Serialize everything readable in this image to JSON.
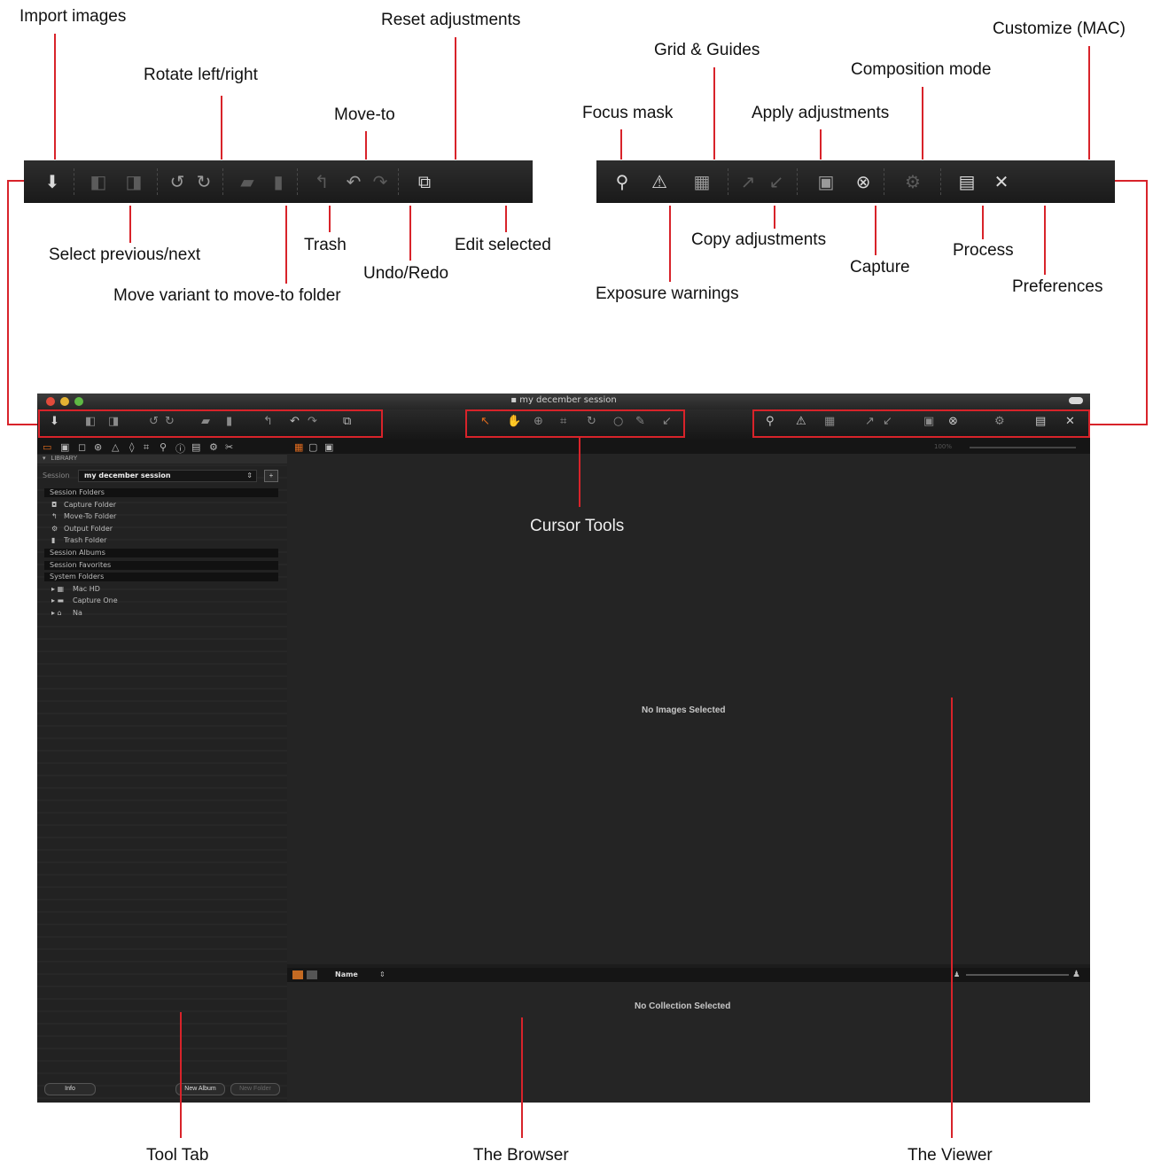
{
  "callouts": {
    "import_images": "Import images",
    "rotate": "Rotate left/right",
    "reset_adjustments": "Reset adjustments",
    "move_to": "Move-to",
    "select_prev_next": "Select previous/next",
    "trash": "Trash",
    "edit_selected": "Edit selected",
    "undo_redo": "Undo/Redo",
    "move_variant": "Move variant to move-to folder",
    "grid_guides": "Grid & Guides",
    "customize": "Customize (MAC)",
    "composition_mode": "Composition mode",
    "focus_mask": "Focus mask",
    "apply_adjustments": "Apply adjustments",
    "copy_adjustments": "Copy adjustments",
    "capture": "Capture",
    "process": "Process",
    "preferences": "Preferences",
    "exposure_warnings": "Exposure warnings",
    "cursor_tools": "Cursor Tools",
    "tool_tab": "Tool Tab",
    "the_browser": "The Browser",
    "the_viewer": "The Viewer"
  },
  "window": {
    "title": "my december session",
    "library_header": "LIBRARY",
    "session_label": "Session",
    "session_value": "my december session",
    "session_folders": "Session Folders",
    "folders": [
      "Capture Folder",
      "Move-To Folder",
      "Output Folder",
      "Trash Folder"
    ],
    "session_albums": "Session Albums",
    "session_favorites": "Session Favorites",
    "system_folders": "System Folders",
    "system_items": [
      "Mac HD",
      "Capture One",
      "Na"
    ],
    "info_button": "Info",
    "new_album_button": "New Album",
    "new_folder_button": "New Folder",
    "viewer_message": "No Images Selected",
    "browser_message": "No Collection Selected",
    "sort_label": "Name",
    "zoom_label": "100%"
  },
  "colors": {
    "accent_red": "#d8232a",
    "cursor_orange": "#e06b1e"
  }
}
